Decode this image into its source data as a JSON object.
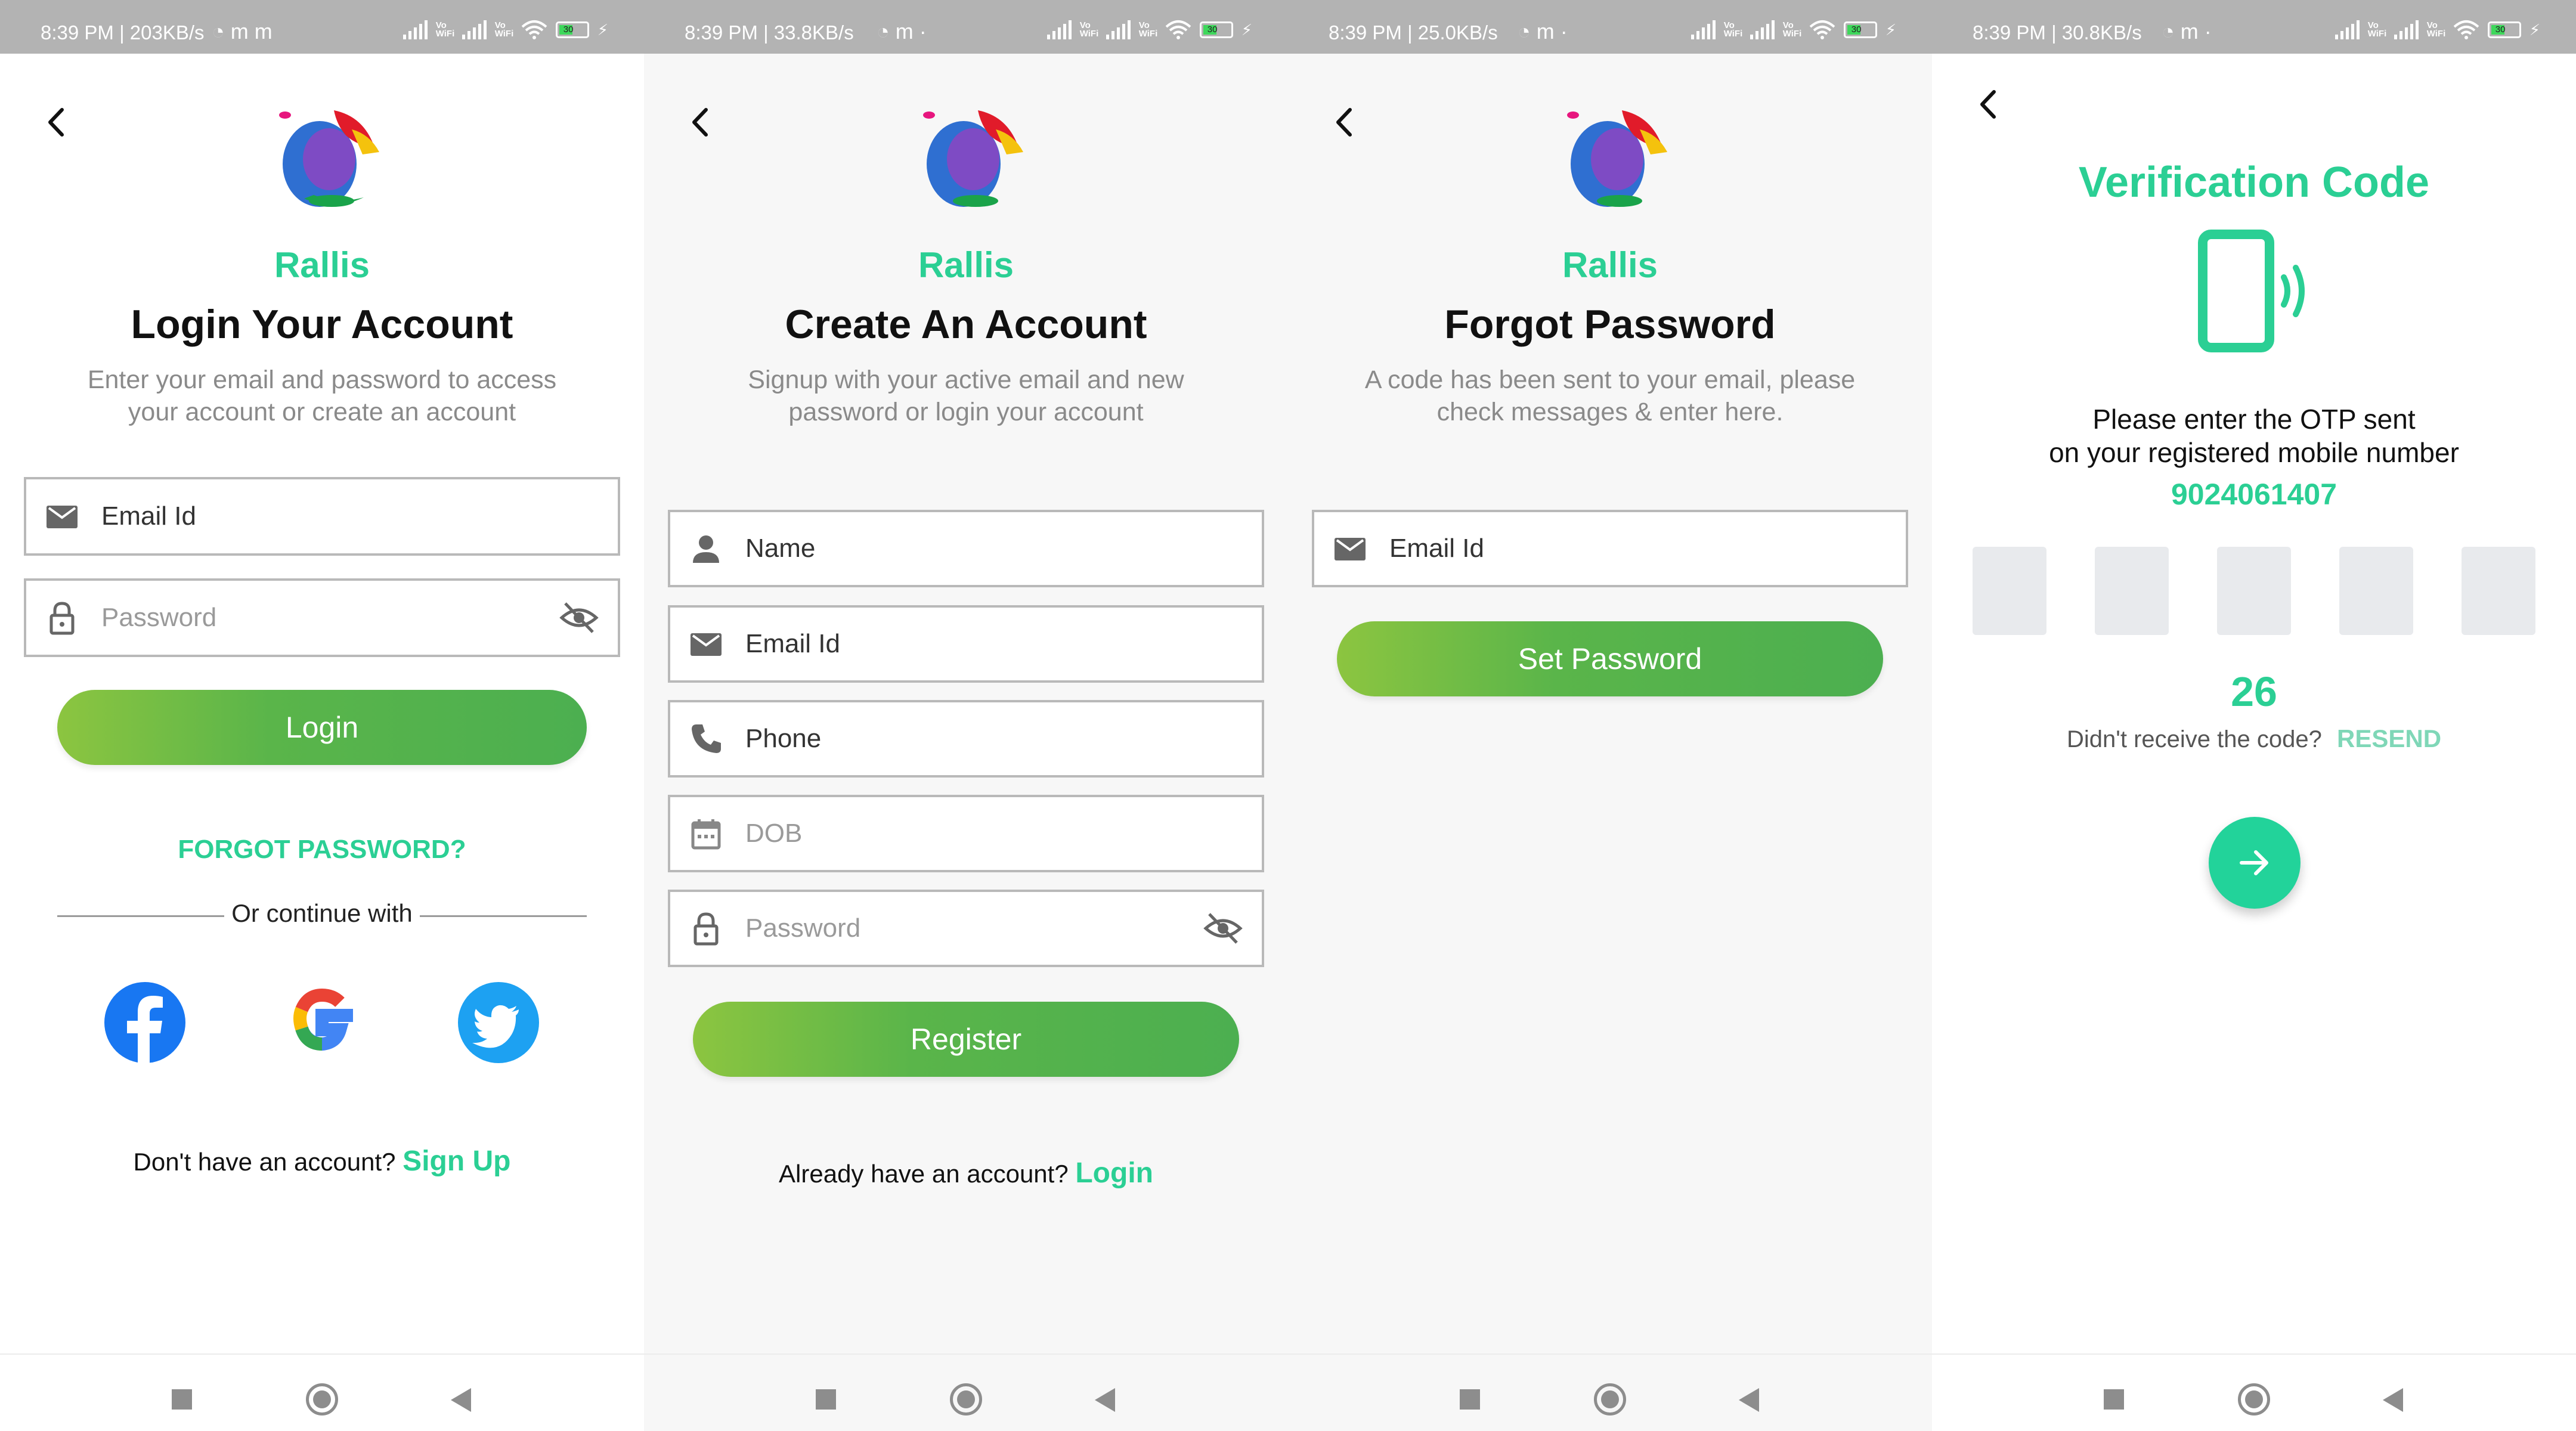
{
  "colors": {
    "accent": "#2bcf94",
    "button_gradient_start": "#8cc540",
    "button_gradient_end": "#4caf50",
    "field_border": "#b9b9b9",
    "subtitle": "#8a8a8a"
  },
  "screens": [
    {
      "status": {
        "time": "8:39 PM | 203KB/s",
        "extra_icons": "◔ m m",
        "battery": "30"
      },
      "brand": "Rallis",
      "heading": "Login Your Account",
      "subtitle": "Enter your email and password to access your account or create an account",
      "fields": [
        {
          "label": "Email Id",
          "icon": "mail-icon"
        },
        {
          "label": "Password",
          "icon": "lock-icon",
          "trailing_icon": "eye-off-icon"
        }
      ],
      "primary_button": "Login",
      "forgot_link": "FORGOT PASSWORD?",
      "divider_text": "Or continue with",
      "social": [
        "facebook-icon",
        "google-icon",
        "twitter-icon"
      ],
      "footer_text": "Don't have an account?",
      "footer_link": "Sign Up"
    },
    {
      "status": {
        "time": "8:39 PM | 33.8KB/s",
        "extra_icons": "◔ m ·",
        "battery": "30"
      },
      "brand": "Rallis",
      "heading": "Create An Account",
      "subtitle": "Signup with your active email and new password or login your account",
      "fields": [
        {
          "label": "Name",
          "icon": "person-icon"
        },
        {
          "label": "Email Id",
          "icon": "mail-icon"
        },
        {
          "label": "Phone",
          "icon": "phone-icon"
        },
        {
          "label": "DOB",
          "icon": "calendar-icon"
        },
        {
          "label": "Password",
          "icon": "lock-icon",
          "trailing_icon": "eye-off-icon"
        }
      ],
      "primary_button": "Register",
      "footer_text": "Already have an account?",
      "footer_link": "Login"
    },
    {
      "status": {
        "time": "8:39 PM | 25.0KB/s",
        "extra_icons": "◔ m ·",
        "battery": "30"
      },
      "brand": "Rallis",
      "heading": "Forgot Password",
      "subtitle": "A code has been sent to your email, please check messages & enter here.",
      "fields": [
        {
          "label": "Email Id",
          "icon": "mail-icon"
        }
      ],
      "primary_button": "Set Password"
    },
    {
      "status": {
        "time": "8:39 PM | 30.8KB/s",
        "extra_icons": "◔ m ·",
        "battery": "30"
      },
      "title": "Verification Code",
      "illustration": "phone-vibrate-icon",
      "otp_text_line1": "Please enter the OTP sent",
      "otp_text_line2": "on your registered mobile number",
      "phone_number": "9024061407",
      "otp_boxes": 5,
      "timer": "26",
      "resend_prompt": "Didn't receive the code?",
      "resend_link": "RESEND",
      "next_button_icon": "arrow-right-icon"
    }
  ],
  "vowifi_label": "Vo WiFi",
  "nav": {
    "recents_icon": "square-icon",
    "home_icon": "circle-icon",
    "back_icon": "triangle-back-icon"
  }
}
